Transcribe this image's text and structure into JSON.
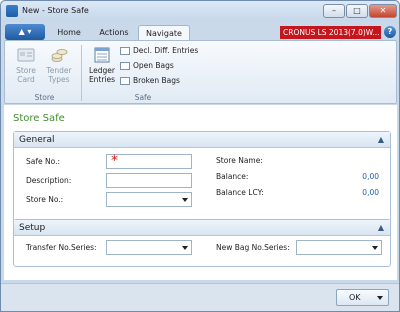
{
  "window": {
    "title": "New - Store Safe",
    "minimize": "–",
    "maximize": "□",
    "close": "✕"
  },
  "ribbon": {
    "app_menu": "▲ ▾",
    "tabs": [
      "Home",
      "Actions",
      "Navigate"
    ],
    "active_tab": "Navigate",
    "company": "CRONUS LS 2013(7.0)W...",
    "help": "?",
    "store_group": {
      "label": "Store",
      "buttons": [
        {
          "label_line1": "Store",
          "label_line2": "Card",
          "icon": "store-card-icon"
        },
        {
          "label_line1": "Tender",
          "label_line2": "Types",
          "icon": "coins-icon"
        }
      ]
    },
    "safe_group": {
      "label": "Safe",
      "ledger_line1": "Ledger",
      "ledger_line2": "Entries",
      "small_buttons": [
        "Decl. Diff. Entries",
        "Open Bags",
        "Broken Bags"
      ]
    }
  },
  "page_title": "Store Safe",
  "general": {
    "title": "General",
    "safe_no_label": "Safe No.:",
    "safe_no_value": "",
    "description_label": "Description:",
    "description_value": "",
    "store_no_label": "Store No.:",
    "store_no_value": "",
    "store_name_label": "Store Name:",
    "balance_label": "Balance:",
    "balance_value": "0,00",
    "balance_lcy_label": "Balance LCY:",
    "balance_lcy_value": "0,00"
  },
  "setup": {
    "title": "Setup",
    "transfer_label": "Transfer No.Series:",
    "new_bag_label": "New Bag No.Series:"
  },
  "footer": {
    "ok_label": "OK"
  },
  "colors": {
    "page_title": "#3e8f2a",
    "company_badge": "#c4161c",
    "value_text": "#1f5fae",
    "required_marker": "#d0211b"
  }
}
